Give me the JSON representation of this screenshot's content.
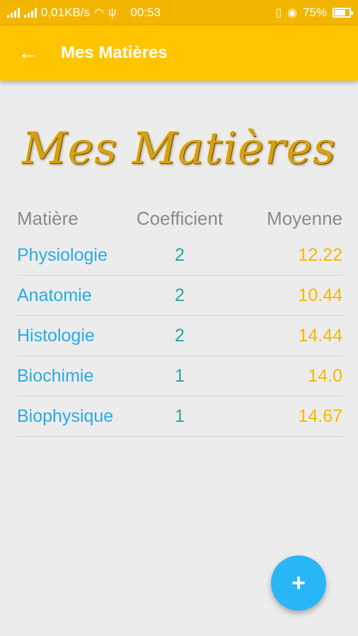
{
  "status_bar": {
    "network_speed": "0,01KB/s",
    "time": "00:53",
    "battery": "75%",
    "battery_level": 0.75,
    "icons": [
      "signal-icon",
      "signal-icon",
      "wifi-icon",
      "usb-icon",
      "vibrate-icon",
      "eye-icon",
      "battery-icon"
    ]
  },
  "app_bar": {
    "title": "Mes Matières",
    "back_icon": "arrow-back-icon"
  },
  "banner": {
    "text": "Mes Matières"
  },
  "table": {
    "headers": {
      "name": "Matière",
      "coef": "Coefficient",
      "avg": "Moyenne"
    },
    "rows": [
      {
        "name": "Physiologie",
        "coef": "2",
        "avg": "12.22"
      },
      {
        "name": "Anatomie",
        "coef": "2",
        "avg": "10.44"
      },
      {
        "name": "Histologie",
        "coef": "2",
        "avg": "14.44"
      },
      {
        "name": "Biochimie",
        "coef": "1",
        "avg": "14.0"
      },
      {
        "name": "Biophysique",
        "coef": "1",
        "avg": "14.67"
      }
    ]
  },
  "fab": {
    "label": "+",
    "icon": "plus-icon"
  },
  "colors": {
    "status_bar": "#f2b600",
    "app_bar": "#ffc400",
    "subject": "#29abe2",
    "coefficient": "#26a69a",
    "average": "#f5b800",
    "fab": "#29b6f6"
  }
}
